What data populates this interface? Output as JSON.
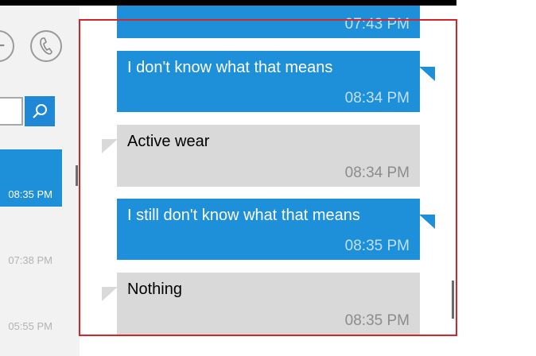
{
  "conversation_list": {
    "items": [
      {
        "time": "08:35 PM",
        "active": true
      },
      {
        "time": "07:38 PM",
        "active": false
      },
      {
        "time": "05:55 PM",
        "active": false
      }
    ]
  },
  "chat": {
    "messages": [
      {
        "direction": "outgoing",
        "text": "",
        "time": "07:43 PM"
      },
      {
        "direction": "outgoing",
        "text": "I don't know what that means",
        "time": "08:34 PM"
      },
      {
        "direction": "incoming",
        "text": "Active wear",
        "time": "08:34 PM"
      },
      {
        "direction": "outgoing",
        "text": "I still don't know what that means",
        "time": "08:35 PM"
      },
      {
        "direction": "incoming",
        "text": "Nothing",
        "time": "08:35 PM"
      }
    ]
  },
  "icons": {
    "add": "plus-icon",
    "call": "phone-icon",
    "search": "search-icon"
  },
  "colors": {
    "outgoing_bubble": "#1e8fd9",
    "incoming_bubble": "#d9d9d9",
    "accent": "#1e88d6",
    "highlight": "#d9232a"
  }
}
